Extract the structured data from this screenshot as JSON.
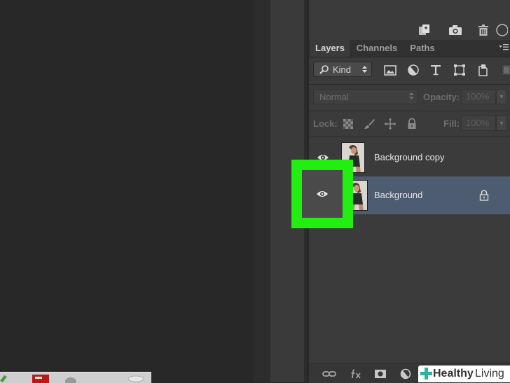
{
  "panel": {
    "tabs": [
      {
        "label": "Layers",
        "active": true
      },
      {
        "label": "Channels",
        "active": false
      },
      {
        "label": "Paths",
        "active": false
      }
    ],
    "filter": {
      "kind_label": "Kind"
    },
    "blend_mode": "Normal",
    "opacity_label": "Opacity:",
    "opacity_value": "100%",
    "lock_label": "Lock:",
    "fill_label": "Fill:",
    "fill_value": "100%",
    "layers": [
      {
        "name": "Background copy",
        "visible": true,
        "selected": false,
        "locked": false
      },
      {
        "name": "Background",
        "visible": true,
        "selected": true,
        "locked": true
      }
    ]
  },
  "highlight": {
    "color": "#22ee11",
    "target": "background-layer-visibility-toggle"
  },
  "watermark": {
    "brand_bold": "Healthy",
    "brand_light": "Living"
  },
  "colors": {
    "selected_layer": "#4d5c70",
    "panel_bg": "#3b3b3b",
    "canvas_bg": "#282828"
  }
}
